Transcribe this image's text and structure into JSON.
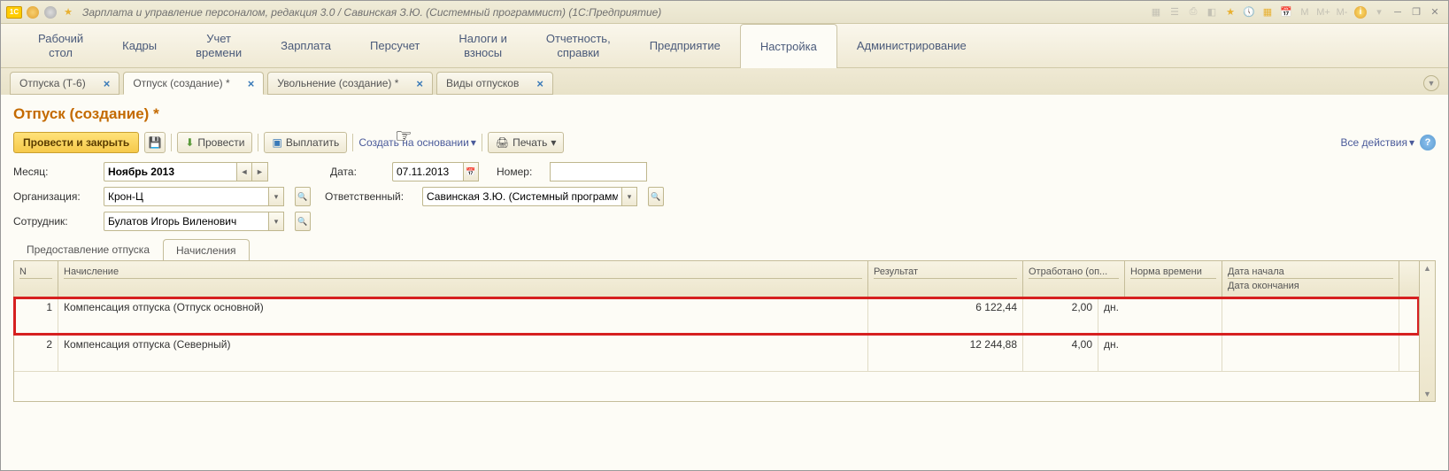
{
  "window_title": "Зарплата и управление персоналом, редакция 3.0 / Савинская З.Ю. (Системный программист)  (1С:Предприятие)",
  "main_nav": [
    {
      "label": "Рабочий\nстол"
    },
    {
      "label": "Кадры"
    },
    {
      "label": "Учет\nвремени"
    },
    {
      "label": "Зарплата"
    },
    {
      "label": "Персучет"
    },
    {
      "label": "Налоги и\nвзносы"
    },
    {
      "label": "Отчетность,\nсправки"
    },
    {
      "label": "Предприятие"
    },
    {
      "label": "Настройка",
      "active": true
    },
    {
      "label": "Администрирование"
    }
  ],
  "doc_tabs": [
    {
      "label": "Отпуска (Т-6)"
    },
    {
      "label": "Отпуск (создание) *",
      "active": true
    },
    {
      "label": "Увольнение (создание) *"
    },
    {
      "label": "Виды отпусков"
    }
  ],
  "page_title": "Отпуск (создание) *",
  "toolbar": {
    "post_close": "Провести и закрыть",
    "post": "Провести",
    "pay": "Выплатить",
    "create_based": "Создать на основании",
    "print": "Печать",
    "all_actions": "Все действия"
  },
  "form": {
    "month_label": "Месяц:",
    "month_value": "Ноябрь 2013",
    "date_label": "Дата:",
    "date_value": "07.11.2013",
    "number_label": "Номер:",
    "number_value": "",
    "org_label": "Организация:",
    "org_value": "Крон-Ц",
    "resp_label": "Ответственный:",
    "resp_value": "Савинская З.Ю. (Системный программист)",
    "emp_label": "Сотрудник:",
    "emp_value": "Булатов Игорь Виленович"
  },
  "sub_tabs": [
    {
      "label": "Предоставление отпуска"
    },
    {
      "label": "Начисления",
      "active": true
    }
  ],
  "grid": {
    "headers": {
      "n": "N",
      "name": "Начисление",
      "result": "Результат",
      "worked": "Отработано (оп...",
      "norm": "Норма времени",
      "date_start": "Дата начала",
      "date_end": "Дата окончания"
    },
    "rows": [
      {
        "n": "1",
        "name": "Компенсация отпуска (Отпуск основной)",
        "result": "6 122,44",
        "worked": "2,00",
        "unit": "дн.",
        "highlight": true
      },
      {
        "n": "2",
        "name": "Компенсация отпуска (Северный)",
        "result": "12 244,88",
        "worked": "4,00",
        "unit": "дн."
      }
    ]
  }
}
